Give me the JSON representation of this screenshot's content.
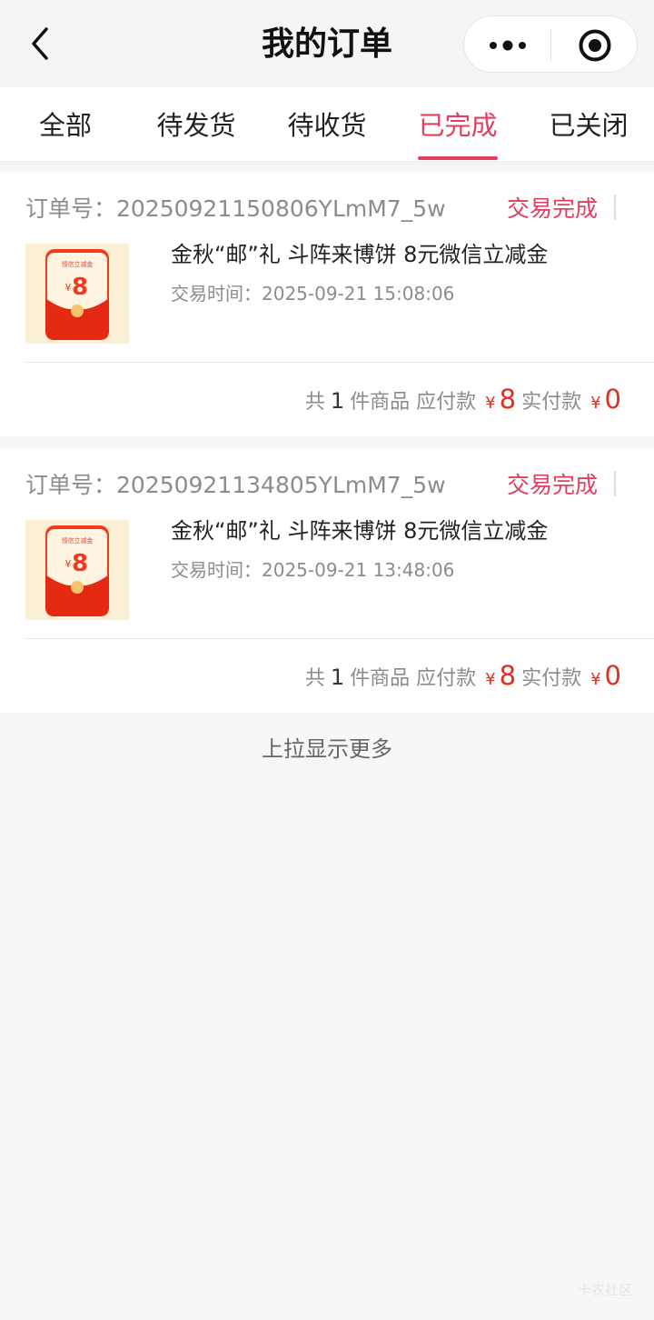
{
  "header": {
    "title": "我的订单"
  },
  "tabs": [
    {
      "label": "全部",
      "active": false
    },
    {
      "label": "待发货",
      "active": false
    },
    {
      "label": "待收货",
      "active": false
    },
    {
      "label": "已完成",
      "active": true
    },
    {
      "label": "已关闭",
      "active": false
    }
  ],
  "orders": [
    {
      "order_no": "订单号：20250921150806YLmM7_5w",
      "status": "交易完成",
      "product": "金秋“邮”礼 斗阵来博饼 8元微信立减金",
      "time": "交易时间：2025-09-21 15:08:06",
      "thumb_label": "领信立减金",
      "thumb_value": "8",
      "summary": {
        "prefix": "共",
        "count": "1",
        "items_label": "件商品 应付款",
        "yen": "¥",
        "payable": "8",
        "paid_label": "实付款",
        "paid": "0"
      }
    },
    {
      "order_no": "订单号：20250921134805YLmM7_5w",
      "status": "交易完成",
      "product": "金秋“邮”礼 斗阵来博饼 8元微信立减金",
      "time": "交易时间：2025-09-21 13:48:06",
      "thumb_label": "领信立减金",
      "thumb_value": "8",
      "summary": {
        "prefix": "共",
        "count": "1",
        "items_label": "件商品 应付款",
        "yen": "¥",
        "payable": "8",
        "paid_label": "实付款",
        "paid": "0"
      }
    }
  ],
  "footer": {
    "load_more": "上拉显示更多",
    "watermark": "卡农社区"
  },
  "colors": {
    "accent": "#e0405e",
    "price": "#e0301e",
    "background": "#f7f7f7"
  }
}
